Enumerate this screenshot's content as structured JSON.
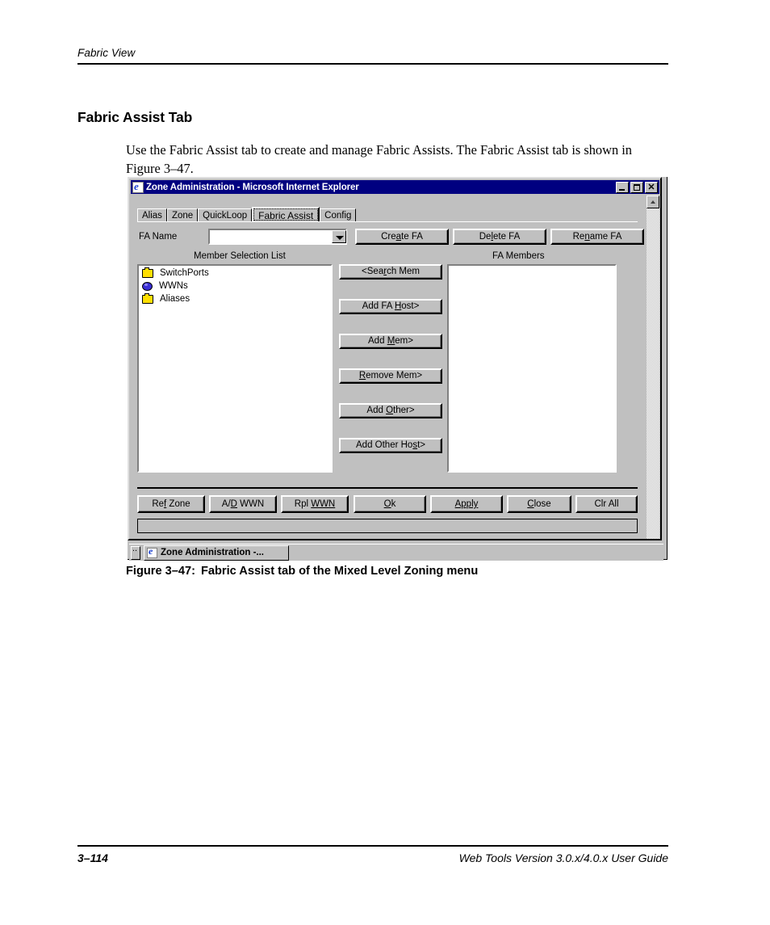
{
  "page": {
    "running_head": "Fabric View",
    "section_title": "Fabric Assist Tab",
    "body_paragraph": "Use the Fabric Assist tab to create and manage Fabric Assists. The Fabric Assist tab is shown in Figure 3–47.",
    "figure_caption_number": "Figure 3–47:",
    "figure_caption_text": "Fabric Assist tab of the Mixed Level Zoning menu",
    "footer_page_number": "3–114",
    "footer_guide_title": "Web Tools Version 3.0.x/4.0.x User Guide"
  },
  "colors": {
    "titlebar": "#000080",
    "dialog_face": "#c0c0c0",
    "folder_icon": "#ffdf00",
    "globe_icon": "#3a2fd6",
    "field_background": "#ffffff"
  },
  "dialog": {
    "title": "Zone Administration - Microsoft Internet Explorer",
    "title_icon": "internet-explorer-icon",
    "window_buttons": [
      {
        "name": "minimize-button",
        "glyph": "minimize-icon"
      },
      {
        "name": "maximize-button",
        "glyph": "maximize-icon"
      },
      {
        "name": "close-button",
        "glyph": "close-icon"
      }
    ],
    "tabs": [
      {
        "label": "Alias",
        "selected": false
      },
      {
        "label": "Zone",
        "selected": false
      },
      {
        "label": "QuickLoop",
        "selected": false
      },
      {
        "label": "Fabric Assist",
        "selected": true
      },
      {
        "label": "Config",
        "selected": false
      }
    ],
    "fa_name": {
      "label": "FA Name",
      "value": "",
      "placeholder": "",
      "dropdown_icon": "chevron-down-icon"
    },
    "name_buttons": [
      {
        "label": "Create FA",
        "mnemonic": "a"
      },
      {
        "label": "Delete FA",
        "mnemonic": "l"
      },
      {
        "label": "Rename FA",
        "mnemonic": "n"
      }
    ],
    "member_selection": {
      "header": "Member Selection List",
      "items": [
        {
          "label": "SwitchPorts",
          "icon": "folder-icon"
        },
        {
          "label": "WWNs",
          "icon": "globe-icon"
        },
        {
          "label": "Aliases",
          "icon": "folder-icon"
        }
      ]
    },
    "fa_members": {
      "header": "FA Members",
      "items": []
    },
    "transfer_buttons": [
      {
        "label": "<Search Mem",
        "mnemonic": "r"
      },
      {
        "label": "Add FA Host>",
        "mnemonic": "H"
      },
      {
        "label": "Add Mem>",
        "mnemonic": "M"
      },
      {
        "label": "Remove Mem>",
        "mnemonic": "R"
      },
      {
        "label": "Add Other>",
        "mnemonic": "O"
      },
      {
        "label": "Add Other Host>",
        "mnemonic": "s"
      }
    ],
    "action_buttons": [
      {
        "label": "Ref Zone",
        "mnemonic": "f"
      },
      {
        "label": "A/D WWN",
        "mnemonic": "D"
      },
      {
        "label": "Rpl WWN",
        "mnemonic": "W"
      },
      {
        "label": "Ok",
        "mnemonic": "O"
      },
      {
        "label": "Apply",
        "mnemonic": "A"
      },
      {
        "label": "Close",
        "mnemonic": "C"
      },
      {
        "label": "Clr All",
        "mnemonic": ""
      }
    ],
    "status_bar_text": "",
    "scrollbar": {
      "up_arrow_icon": "scroll-up-icon"
    }
  },
  "taskbar": {
    "task_button_label": "Zone Administration -...",
    "task_button_icon": "internet-explorer-icon"
  }
}
